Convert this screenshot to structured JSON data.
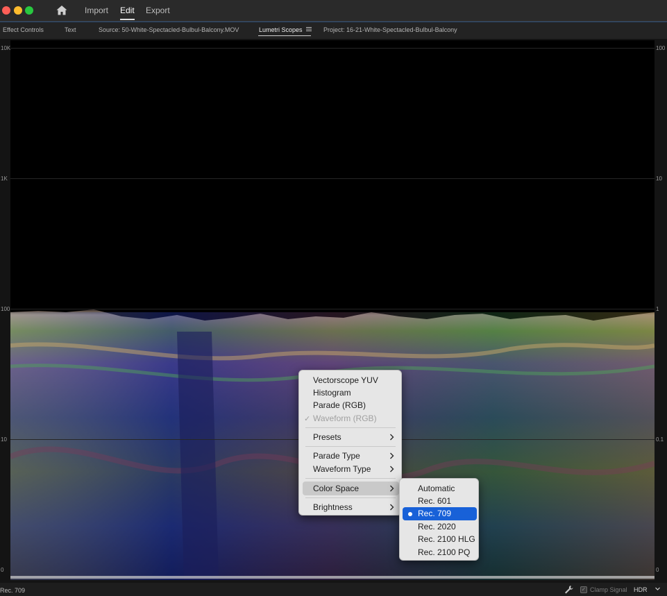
{
  "window": {
    "nav": {
      "import": "Import",
      "edit": "Edit",
      "export": "Export"
    }
  },
  "tabs": {
    "effect_controls": "Effect Controls",
    "text": "Text",
    "source": "Source: 50-White-Spectacled-Bulbul-Balcony.MOV",
    "lumetri": "Lumetri Scopes",
    "project": "Project: 16-21-White-Spectacled-Bulbul-Balcony"
  },
  "scope": {
    "left_ticks": [
      "10K",
      "1K",
      "100",
      "10",
      "0"
    ],
    "right_ticks": [
      "100",
      "10",
      "1",
      "0.1",
      "0"
    ]
  },
  "menu": {
    "items": [
      "Vectorscope YUV",
      "Histogram",
      "Parade (RGB)",
      "Waveform (RGB)",
      "Presets",
      "Parade Type",
      "Waveform Type",
      "Color Space",
      "Brightness"
    ],
    "checked_item": "Waveform (RGB)",
    "check_mark": "✓"
  },
  "submenu": {
    "items": [
      "Automatic",
      "Rec. 601",
      "Rec. 709",
      "Rec. 2020",
      "Rec. 2100 HLG",
      "Rec. 2100 PQ"
    ],
    "selected": "Rec. 709"
  },
  "status": {
    "color_space": "Rec. 709",
    "clamp_label": "Clamp Signal",
    "clamp_checked": true,
    "hdr_label": "HDR"
  },
  "colors": {
    "accent_selection": "#1861d8",
    "menu_bg": "#e6e6e6",
    "app_bg": "#1e1e1e"
  },
  "icons": [
    "home-icon",
    "hamburger-menu-icon",
    "wrench-icon",
    "chevron-down-icon",
    "chevron-right-icon",
    "checkmark-icon",
    "bullet-icon"
  ]
}
